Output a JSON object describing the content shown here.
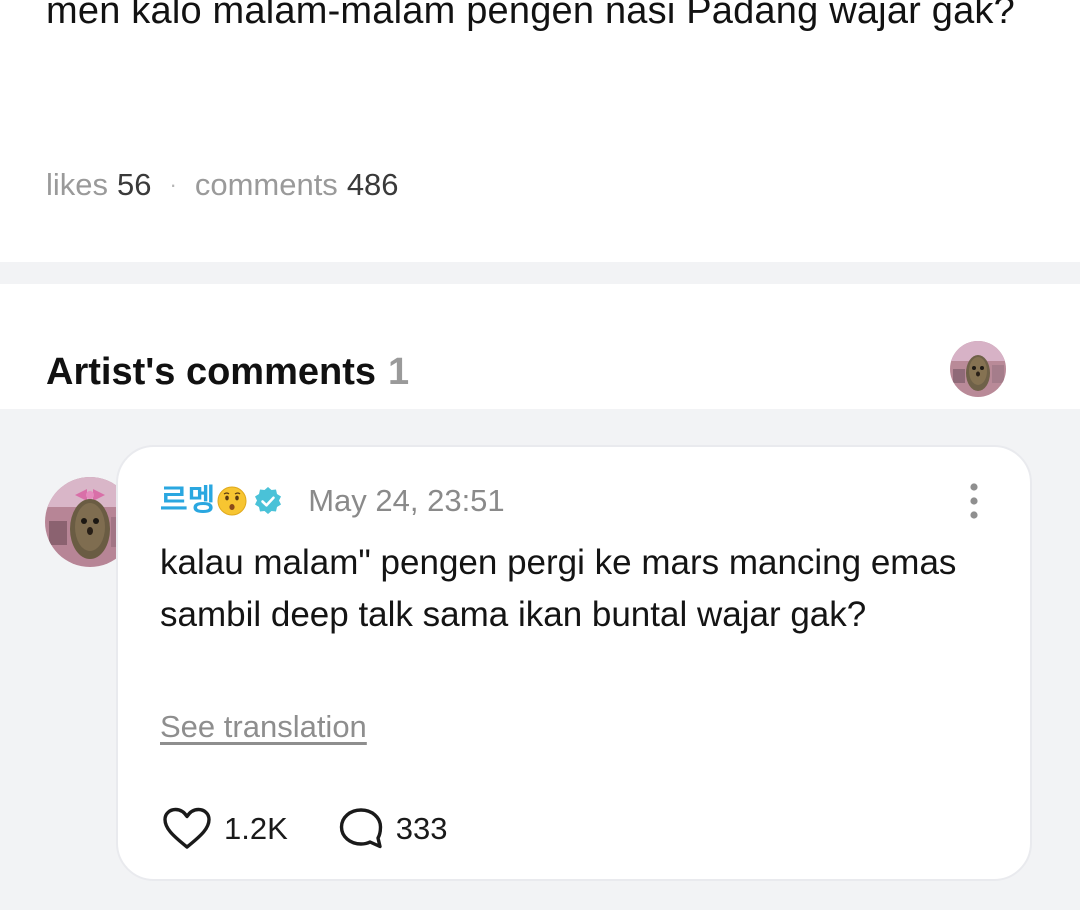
{
  "post": {
    "text": "men kalo malam-malam pengen nasi Padang wajar gak?",
    "likes_label": "likes",
    "likes_value": "56",
    "separator": "·",
    "comments_label": "comments",
    "comments_value": "486"
  },
  "artist_section": {
    "title": "Artist's comments",
    "count": "1",
    "avatar_icon": "artist-avatar-icon"
  },
  "comment": {
    "author": "르멩",
    "author_emoji": "kissing-face-emoji",
    "verified_icon": "verified-badge-icon",
    "time": "May 24, 23:51",
    "body": "kalau malam\"  pengen pergi ke mars mancing emas sambil deep talk sama ikan buntal wajar gak?",
    "see_translation": "See translation",
    "like_count": "1.2K",
    "reply_count": "333",
    "more_icon": "more-vertical-icon"
  },
  "colors": {
    "accent": "#2aa7e0",
    "verified": "#4ac2d8",
    "muted": "#9a9a9a",
    "band": "#f2f3f5"
  }
}
